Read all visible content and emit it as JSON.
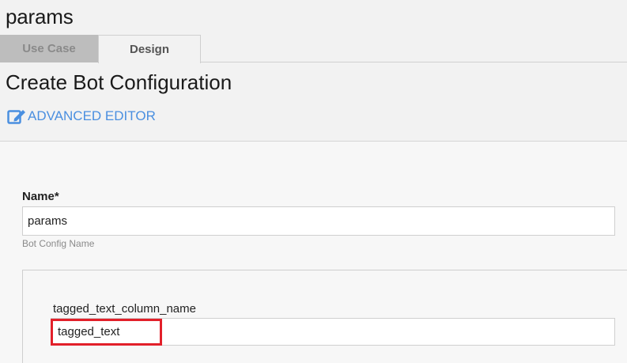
{
  "header": {
    "title": "params"
  },
  "tabs": [
    {
      "label": "Use Case",
      "active": false
    },
    {
      "label": "Design",
      "active": true
    }
  ],
  "main": {
    "title": "Create Bot Configuration",
    "advanced_editor_label": "ADVANCED EDITOR",
    "advanced_editor_icon": "edit-icon"
  },
  "form": {
    "name_label": "Name*",
    "name_value": "params",
    "name_help": "Bot Config Name",
    "tagged_text_label": "tagged_text_column_name",
    "tagged_text_value": "tagged_text"
  },
  "colors": {
    "link": "#4a8fe0",
    "highlight": "#e2202a",
    "inactive_tab_bg": "#bdbdbd"
  }
}
